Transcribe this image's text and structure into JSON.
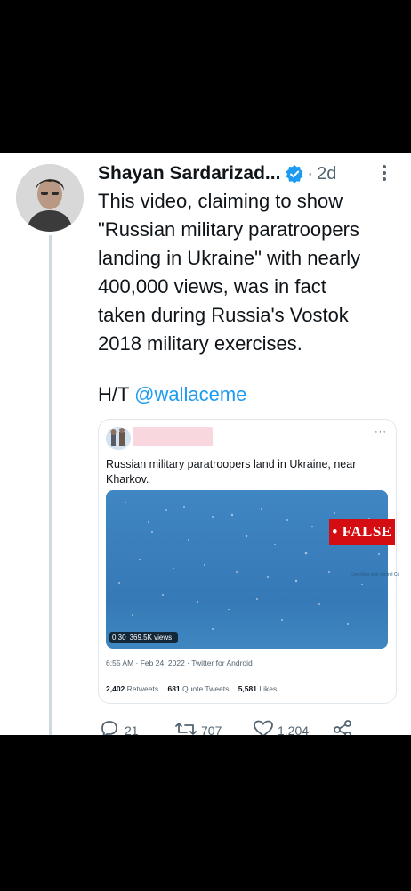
{
  "tweet": {
    "author": "Shayan Sardarizad...",
    "separator": "·",
    "time": "2d",
    "text": "This video, claiming to show\n\"Russian military paratroopers\nlanding in Ukraine\" with nearly\n400,000 views, was in fact\ntaken during Russia's Vostok\n2018 military exercises.",
    "ht_prefix": "H/T ",
    "ht_handle": "@wallaceme",
    "verified_color": "#1d9bf0"
  },
  "quoted": {
    "text": "Russian military paratroopers land in Ukraine, near Kharkov.",
    "more": "···",
    "video_time": "0:30",
    "video_views": "369.5K views",
    "meta": "6:55 AM · Feb 24, 2022 · Twitter for Android",
    "stats": [
      {
        "count": "2,402",
        "label": "Retweets"
      },
      {
        "count": "681",
        "label": "Quote Tweets"
      },
      {
        "count": "5,581",
        "label": "Likes"
      }
    ]
  },
  "overlay": {
    "false_label": "• FALSE",
    "false_color": "#d40d12",
    "caption": "Contrôles oral control Co"
  },
  "actions": {
    "reply_count": "21",
    "retweet_count": "707",
    "like_count": "1,204"
  }
}
